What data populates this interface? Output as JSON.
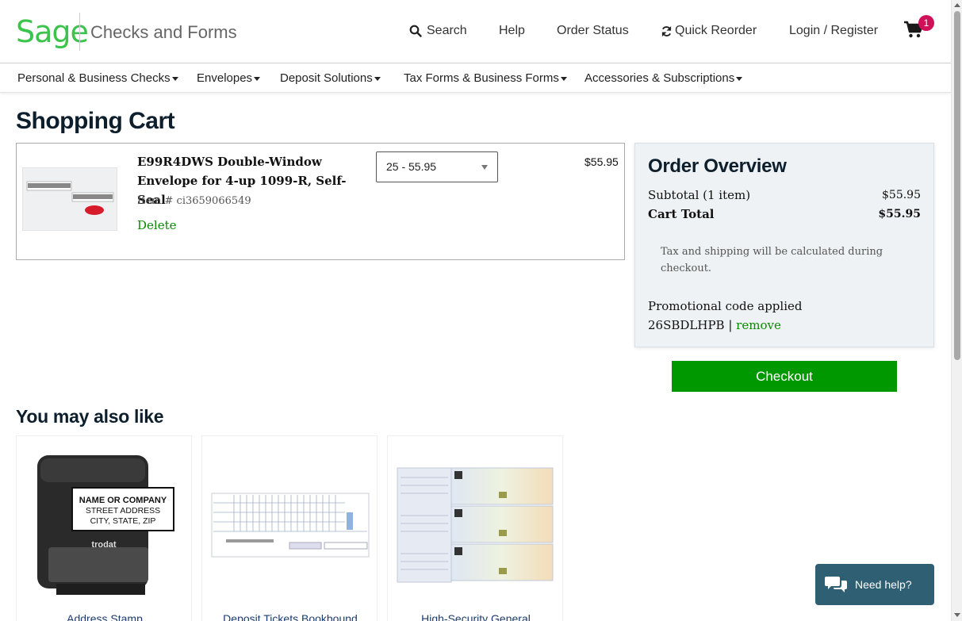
{
  "header": {
    "logo": "Sage",
    "brand_sub": "Checks and Forms",
    "nav": {
      "search": "Search",
      "help": "Help",
      "order_status": "Order Status",
      "quick_reorder": "Quick Reorder",
      "login": "Login / Register"
    },
    "cart_count": "1"
  },
  "categories": [
    "Personal & Business Checks",
    "Envelopes",
    "Deposit Solutions",
    "Tax Forms & Business Forms",
    "Accessories & Subscriptions"
  ],
  "page_title": "Shopping Cart",
  "cart_item": {
    "title": "E99R4DWS Double-Window Envelope for 4-up 1099-R, Self-Seal",
    "item_number": "Item # ci3659066549",
    "delete_label": "Delete",
    "quantity_selected": "25 - 55.95",
    "price": "$55.95"
  },
  "overview": {
    "title": "Order Overview",
    "subtotal_label": "Subtotal (1 item)",
    "subtotal_value": "$55.95",
    "total_label": "Cart Total",
    "total_value": "$55.95",
    "note": "Tax and shipping will be calculated during checkout.",
    "promo_label": "Promotional code applied",
    "promo_code": "26SBDLHPB",
    "promo_separator": " | ",
    "promo_remove": "remove"
  },
  "checkout_label": "Checkout",
  "recommendations": {
    "title": "You may also like",
    "items": [
      {
        "label": "Address Stamp",
        "stamp_lines": [
          "NAME OR COMPANY",
          "STREET ADDRESS",
          "CITY, STATE, ZIP"
        ],
        "stamp_brand": "trodat"
      },
      {
        "label": "Deposit Tickets Bookbound"
      },
      {
        "label": "High-Security General"
      }
    ]
  },
  "help_label": "Need help?",
  "colors": {
    "brand_green": "#3bc44b",
    "link_green": "#0a8a00",
    "checkout_green": "#009800",
    "badge": "#d0115a",
    "help_bg": "#2e5f73"
  }
}
